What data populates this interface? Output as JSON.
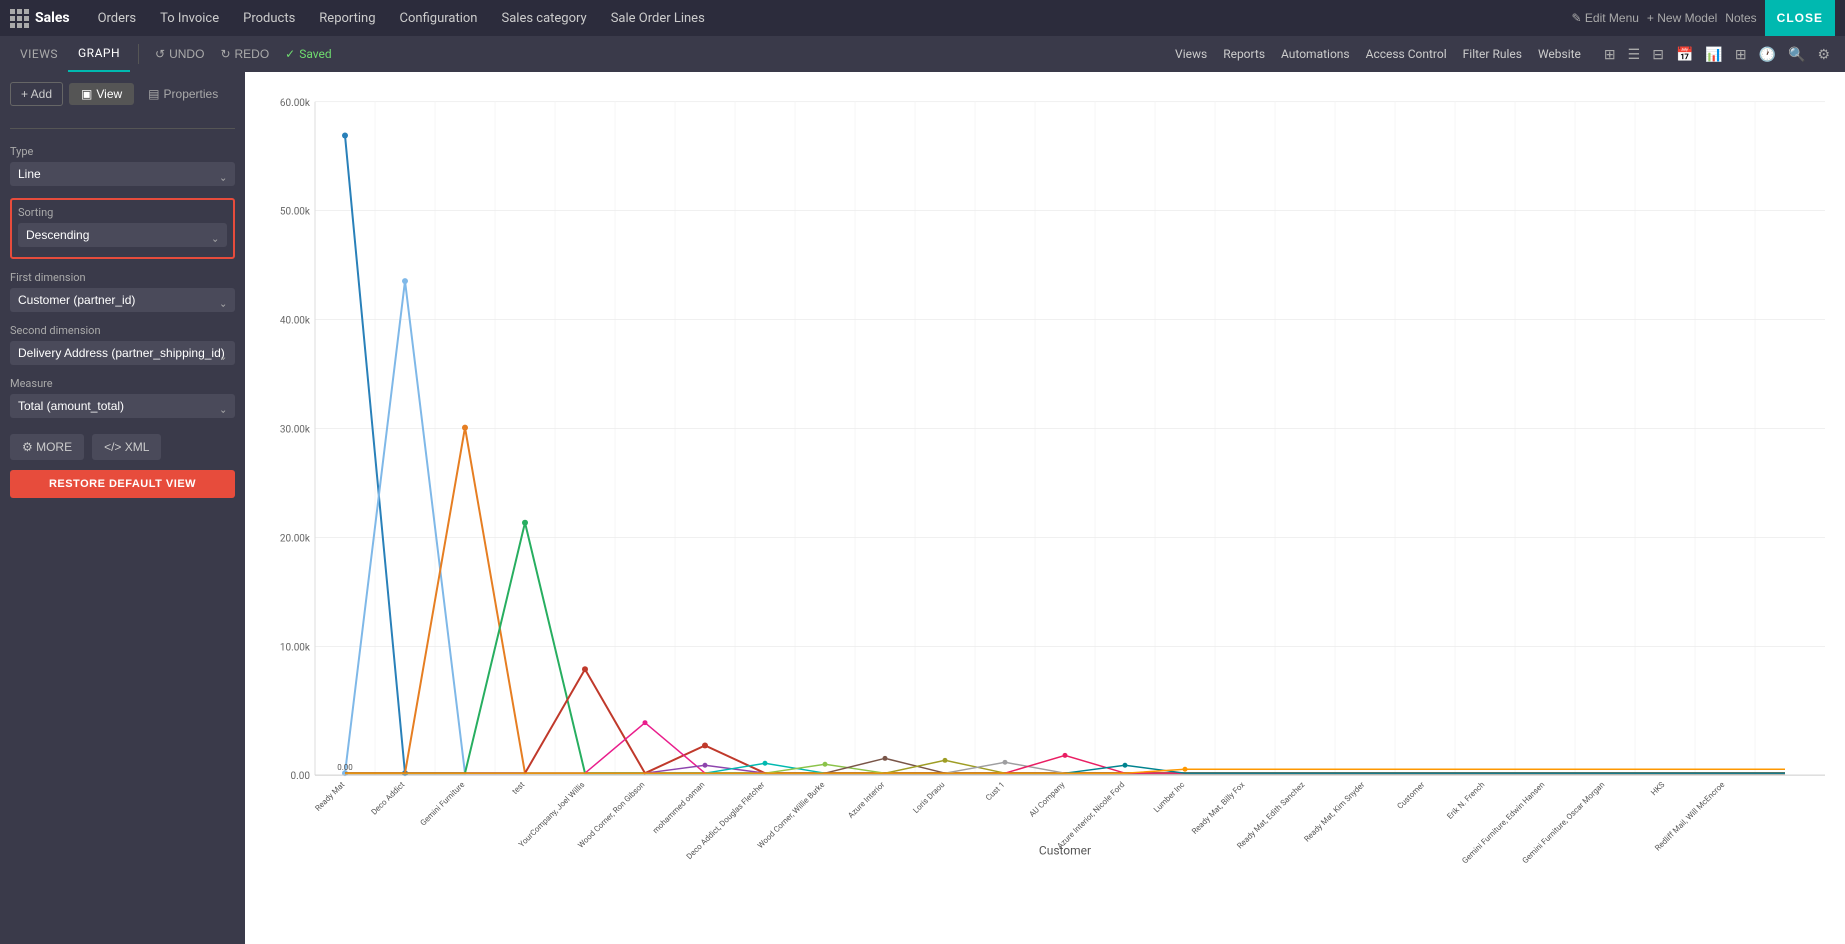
{
  "topnav": {
    "app_label": "Sales",
    "items": [
      {
        "label": "Orders"
      },
      {
        "label": "To Invoice"
      },
      {
        "label": "Products"
      },
      {
        "label": "Reporting"
      },
      {
        "label": "Configuration"
      },
      {
        "label": "Sales category"
      },
      {
        "label": "Sale Order Lines"
      }
    ],
    "edit_menu": "✎ Edit Menu",
    "new_model": "+ New Model",
    "notes": "Notes",
    "close": "CLOSE"
  },
  "secondary": {
    "views_label": "VIEWS",
    "graph_label": "GRAPH",
    "undo": "UNDO",
    "redo": "REDO",
    "saved": "Saved",
    "right_items": [
      "Views",
      "Reports",
      "Automations",
      "Access Control",
      "Filter Rules",
      "Website"
    ]
  },
  "sidebar": {
    "add_label": "+ Add",
    "view_label": "View",
    "properties_label": "Properties",
    "type_label": "Type",
    "type_value": "Line",
    "sorting_label": "Sorting",
    "sorting_value": "Descending",
    "first_dim_label": "First dimension",
    "first_dim_value": "Customer (partner_id)",
    "second_dim_label": "Second dimension",
    "second_dim_value": "Delivery Address (partner_shipping_id)",
    "measure_label": "Measure",
    "measure_value": "Total (amount_total)",
    "more_btn": "⚙ MORE",
    "xml_btn": "</> XML",
    "restore_btn": "RESTORE DEFAULT VIEW"
  },
  "chart": {
    "x_label": "Customer",
    "y_max": "60.00k",
    "y_values": [
      "60.00k",
      "50.00k",
      "40.00k",
      "30.00k",
      "20.00k",
      "10.00k",
      "0.00"
    ],
    "x_labels": [
      "Ready Mat",
      "Deco Addict",
      "Gemini Furniture",
      "test",
      "YourCompany, Joel Willis",
      "Wood Corner, Ron Gibson",
      "mohammed osman",
      "Deco Addict, Douglas Fletcher",
      "Wood Corner, Willie Burke",
      "Azure Interior",
      "Loris Draou",
      "Cust 1",
      "AU Company",
      "Azure Interior, Nicole Ford",
      "Lumber Inc",
      "Ready Mat, Billy Fox",
      "Ready Mat, Edith Sanchez",
      "Ready Mat, Kim Snyder",
      "Customer",
      "Erik N. French",
      "Gemini Furniture, Edwin Hansen",
      "Gemini Furniture, Oscar Morgan",
      "HKS",
      "Redliff Mail, Will McEncroe"
    ],
    "accent": "#00b9b0"
  }
}
